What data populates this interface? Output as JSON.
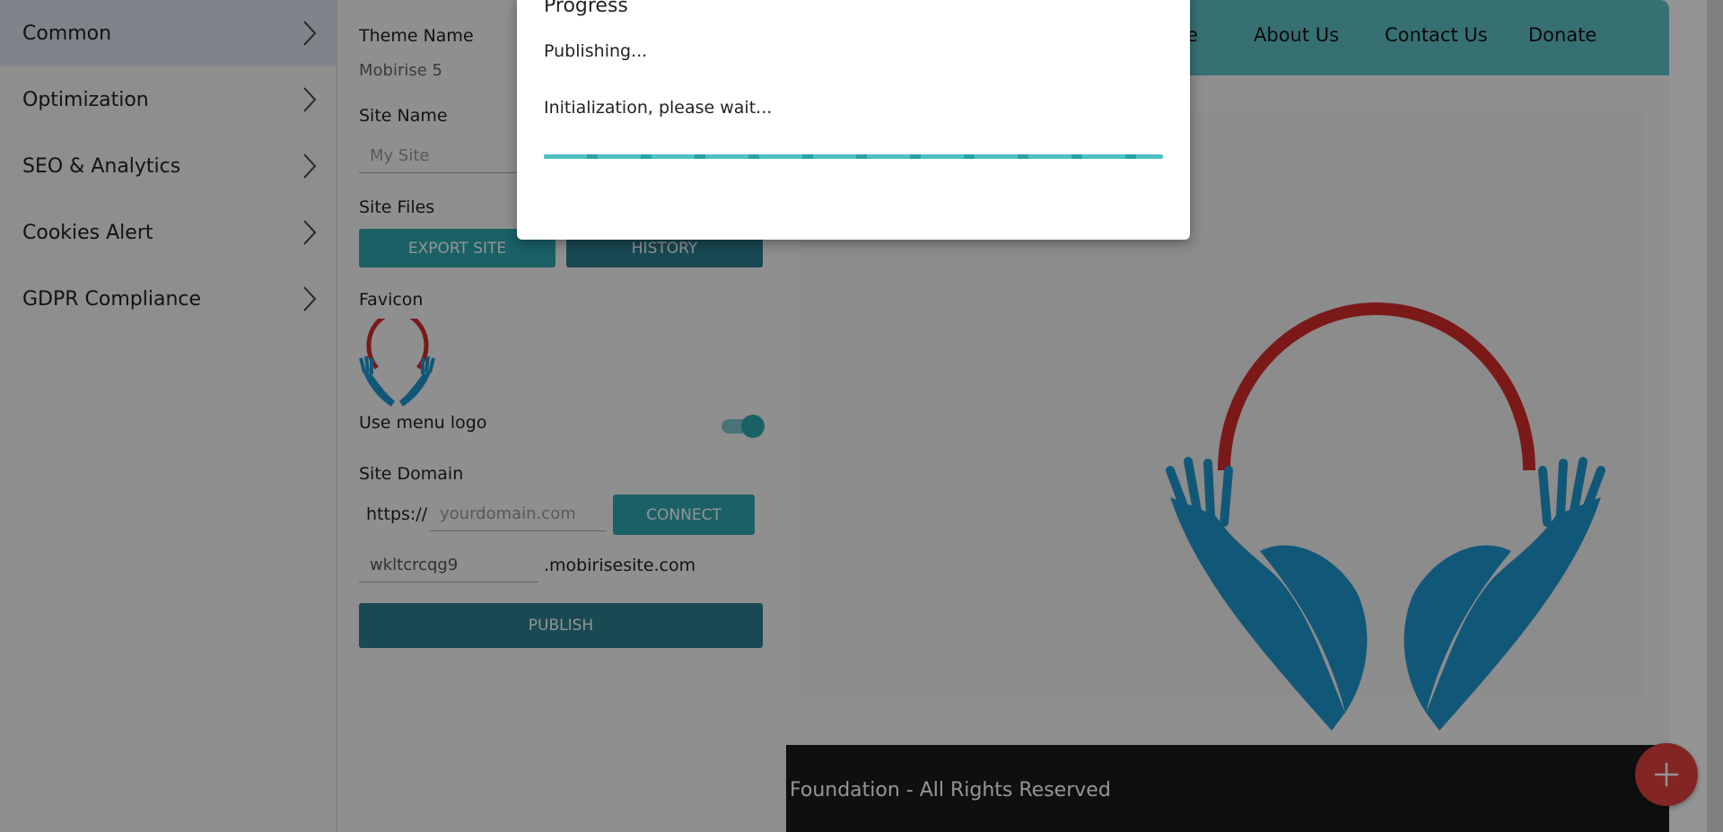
{
  "sidebar": {
    "items": [
      {
        "label": "Common",
        "active": true
      },
      {
        "label": "Optimization"
      },
      {
        "label": "SEO & Analytics"
      },
      {
        "label": "Cookies Alert"
      },
      {
        "label": "GDPR Compliance"
      }
    ]
  },
  "panel": {
    "theme_name_label": "Theme Name",
    "theme_name_value": "Mobirise 5",
    "site_name_label": "Site Name",
    "site_name_placeholder": "My Site",
    "site_files_label": "Site Files",
    "export_button": "EXPORT SITE",
    "history_button": "HISTORY",
    "favicon_label": "Favicon",
    "use_menu_logo_label": "Use menu logo",
    "use_menu_logo_on": true,
    "site_domain_label": "Site Domain",
    "domain_prefix": "https://",
    "domain_placeholder": "yourdomain.com",
    "connect_button": "CONNECT",
    "subdomain_value": "wkltcrcqg9",
    "subdomain_suffix": ".mobirisesite.com",
    "publish_button": "PUBLISH"
  },
  "preview": {
    "nav_links": [
      "e",
      "About Us",
      "Contact Us",
      "Donate"
    ],
    "footer_text": "Foundation - All Rights Reserved"
  },
  "modal": {
    "title": "Progress",
    "status": "Publishing...",
    "substatus": "Initialization, please wait..."
  },
  "colors": {
    "accent": "#2ea8b0",
    "nav_bg": "#5fc2c6",
    "fab": "#e2403d",
    "logo_red": "#d42b2b",
    "logo_blue": "#1e96cf"
  },
  "icons": {
    "sidebar_chevron": "chevron-right-icon",
    "fab": "plus-icon"
  }
}
